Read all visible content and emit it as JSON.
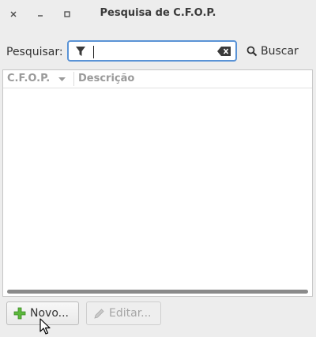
{
  "window": {
    "title": "Pesquisa de C.F.O.P.",
    "close_glyph": "×",
    "minimize_glyph": "–",
    "maximize_glyph": "□"
  },
  "search": {
    "label": "Pesquisar:",
    "value": "",
    "filter_icon": "filter-icon",
    "clear_icon": "clear-text-icon",
    "button_label": "Buscar",
    "button_icon": "search-icon"
  },
  "table": {
    "columns": [
      {
        "label": "C.F.O.P.",
        "sorted": "descending"
      },
      {
        "label": "Descrição"
      }
    ],
    "rows": []
  },
  "actions": {
    "new_label": "Novo...",
    "new_icon": "plus-icon",
    "edit_label": "Editar...",
    "edit_icon": "pencil-icon",
    "edit_enabled": false
  },
  "colors": {
    "accent_border": "#5a93d6",
    "plus_icon": "#5cb83c"
  }
}
